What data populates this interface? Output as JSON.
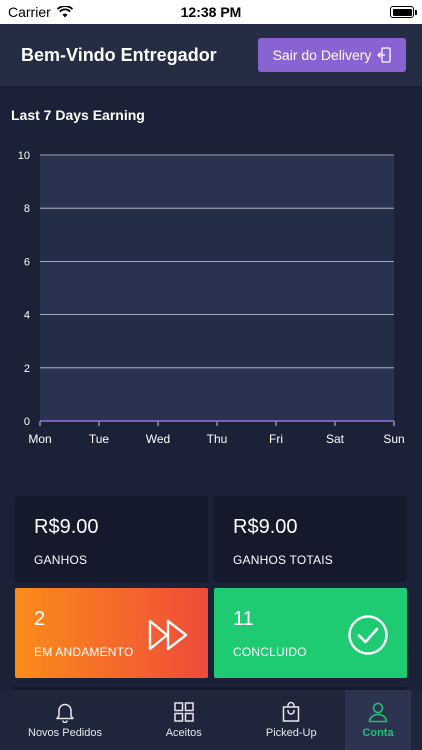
{
  "status_bar": {
    "carrier": "Carrier",
    "time": "12:38 PM"
  },
  "header": {
    "title": "Bem-Vindo Entregador",
    "logout_label": "Sair do Delivery"
  },
  "chart_title": "Last 7 Days Earning",
  "chart_data": {
    "type": "area",
    "title": "Last 7 Days Earning",
    "categories": [
      "Mon",
      "Tue",
      "Wed",
      "Thu",
      "Fri",
      "Sat",
      "Sun"
    ],
    "values": [
      0,
      0,
      0,
      0,
      0,
      0,
      0
    ],
    "yticks": [
      "0",
      "2",
      "4",
      "6",
      "8",
      "10"
    ],
    "ylim": [
      0,
      10
    ],
    "grid": true
  },
  "cards": {
    "earnings": {
      "value": "R$9.00",
      "label": "GANHOS"
    },
    "total_earnings": {
      "value": "R$9.00",
      "label": "GANHOS TOTAIS"
    },
    "in_progress": {
      "value": "2",
      "label": "EM ANDAMENTO"
    },
    "completed": {
      "value": "11",
      "label": "CONCLUIDO"
    }
  },
  "tabs": [
    {
      "label": "Novos Pedidos",
      "icon": "bell-icon"
    },
    {
      "label": "Aceitos",
      "icon": "grid-icon"
    },
    {
      "label": "Picked-Up",
      "icon": "shopping-bag-icon"
    },
    {
      "label": "Conta",
      "icon": "user-icon"
    }
  ],
  "colors": {
    "background": "#1b2136",
    "header": "#252d45",
    "accent_purple": "#8a63d2",
    "accent_green": "#1ecb73",
    "accent_orange": "#fb8c1a",
    "active_tab_text": "#21c07a"
  }
}
